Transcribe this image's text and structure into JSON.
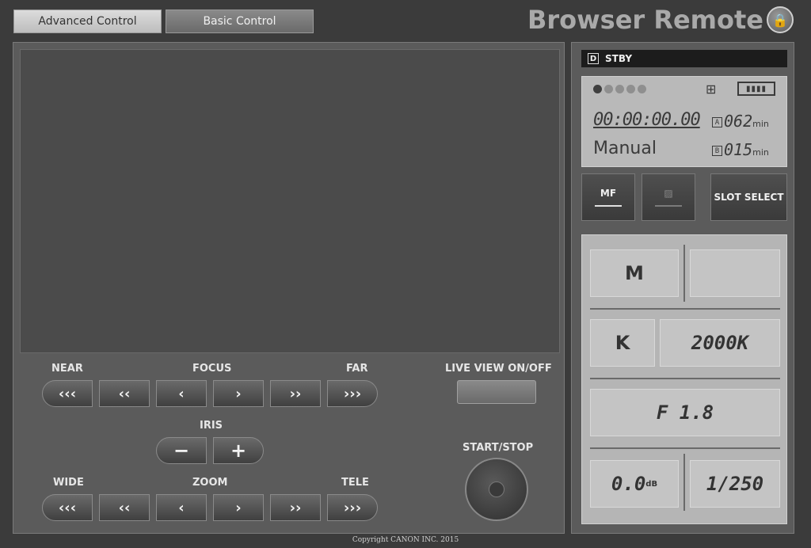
{
  "tabs": [
    {
      "label": "Advanced Control"
    },
    {
      "label": "Basic Control"
    }
  ],
  "app_title": "Browser Remote",
  "focus": {
    "near_label": "NEAR",
    "title": "FOCUS",
    "far_label": "FAR",
    "buttons": [
      "‹‹‹",
      "‹‹",
      "‹",
      "›",
      "››",
      "›››"
    ]
  },
  "iris": {
    "title": "IRIS",
    "minus": "−",
    "plus": "+"
  },
  "zoom": {
    "wide_label": "WIDE",
    "title": "ZOOM",
    "tele_label": "TELE",
    "buttons": [
      "‹‹‹",
      "‹‹",
      "‹",
      "›",
      "››",
      "›››"
    ]
  },
  "live_view": {
    "label": "LIVE VIEW  ON/OFF"
  },
  "start_stop": {
    "label": "START/STOP"
  },
  "copyright": "Copyright CANON INC. 2015",
  "status": {
    "mode_icon": "D",
    "text": "STBY"
  },
  "lcd": {
    "timecode": "00:00:00.00",
    "mode": "Manual",
    "slot_a": {
      "key": "A",
      "value": "062",
      "unit": "min"
    },
    "slot_b": {
      "key": "B",
      "value": "015",
      "unit": "min"
    },
    "battery": "▮▮▮▮"
  },
  "side_buttons": {
    "mf": "MF",
    "slot_select": "SLOT SELECT"
  },
  "camera": {
    "exposure_mode": "M",
    "wb_mode": "K",
    "wb_value": "2000K",
    "aperture": "F 1.8",
    "gain_value": "0.0",
    "gain_unit": "dB",
    "shutter": "1/250"
  }
}
